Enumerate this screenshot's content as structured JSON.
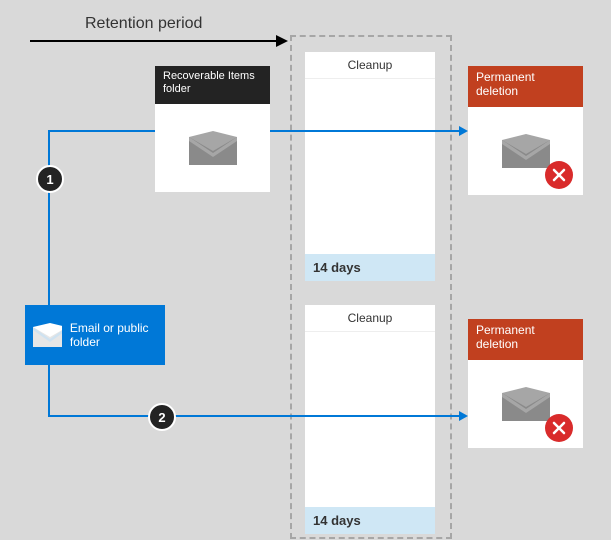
{
  "retention_label": "Retention period",
  "steps": {
    "one": "1",
    "two": "2"
  },
  "source": {
    "label": "Email or public folder"
  },
  "recoverable": {
    "label": "Recoverable Items folder"
  },
  "cleanup": {
    "label": "Cleanup",
    "duration": "14 days"
  },
  "permanent": {
    "label": "Permanent deletion"
  },
  "icons": {
    "envelope": "envelope-icon",
    "delete": "delete-x-icon"
  }
}
